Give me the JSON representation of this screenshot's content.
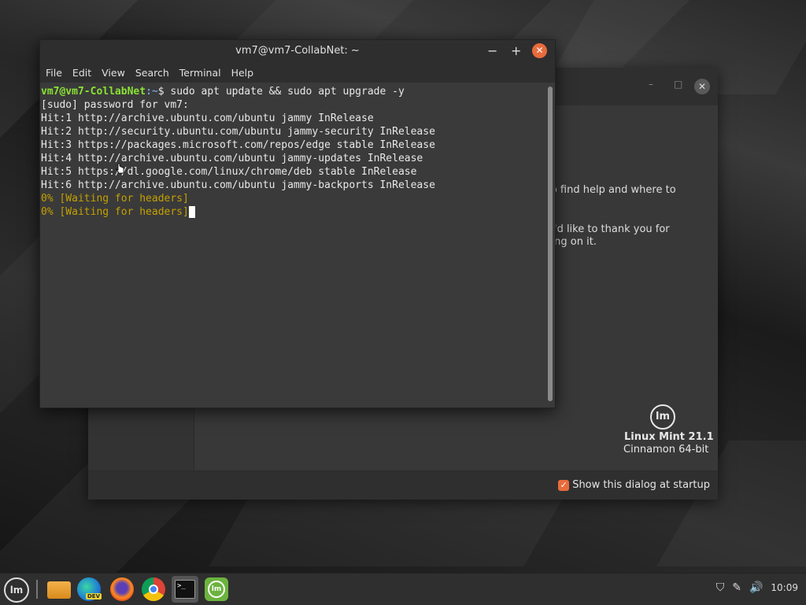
{
  "terminal": {
    "title": "vm7@vm7-CollabNet: ~",
    "menu": [
      "File",
      "Edit",
      "View",
      "Search",
      "Terminal",
      "Help"
    ],
    "prompt_user": "vm7@vm7-CollabNet",
    "prompt_path": ":~",
    "prompt_symbol": "$ ",
    "command": "sudo apt update && sudo apt upgrade -y",
    "output": [
      "[sudo] password for vm7:",
      "Hit:1 http://archive.ubuntu.com/ubuntu jammy InRelease",
      "Hit:2 http://security.ubuntu.com/ubuntu jammy-security InRelease",
      "Hit:3 https://packages.microsoft.com/repos/edge stable InRelease",
      "Hit:4 http://archive.ubuntu.com/ubuntu jammy-updates InRelease",
      "Hit:5 https://dl.google.com/linux/chrome/deb stable InRelease",
      "Hit:6 http://archive.ubuntu.com/ubuntu jammy-backports InRelease"
    ],
    "waiting": [
      "0% [Waiting for headers]",
      "0% [Waiting for headers]"
    ]
  },
  "welcome": {
    "text1": "ow to find help and where to",
    "text2": "t, we'd like to thank you for",
    "text3": "vorking on it.",
    "logo_text": "lm",
    "version": "Linux Mint 21.1",
    "edition": "Cinnamon 64-bit",
    "show_startup": "Show this dialog at startup",
    "show_startup_checked": true
  },
  "taskbar": {
    "menu_logo": "lm",
    "edge_badge": "DEV",
    "terminal_glyph": ">_",
    "mint_app_glyph": "lm",
    "clock": "10:09"
  },
  "colors": {
    "accent": "#e96b3c",
    "prompt_user": "#8ae234",
    "prompt_path": "#729fcf",
    "waiting": "#c4a000"
  }
}
